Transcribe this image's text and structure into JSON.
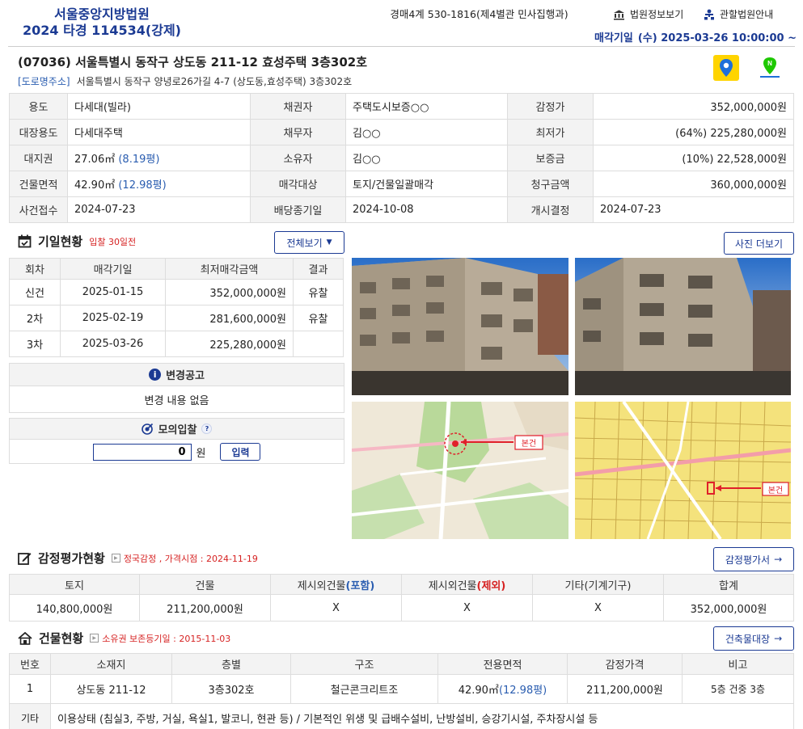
{
  "court": {
    "name": "서울중앙지방법원",
    "case": "2024 타경 114534(강제)"
  },
  "case_dept": "경매4계 530-1816(제4별관 민사집행과)",
  "links": {
    "court_info": "법원정보보기",
    "jurisdiction": "관할법원안내"
  },
  "sale_date": {
    "label": "매각기일",
    "value": "(수) 2025-03-26 10:00:00 ~"
  },
  "address": {
    "main": "(07036) 서울특별시 동작구 상도동 211-12 효성주택 3층302호",
    "road_tag": "[도로명주소]",
    "road": "서울특별시 동작구 양녕로26가길 4-7 (상도동,효성주택) 3층302호"
  },
  "info": {
    "usage_label": "용도",
    "usage": "다세대(빌라)",
    "creditor_label": "채권자",
    "creditor": "주택도시보증○○",
    "appraisal_label": "감정가",
    "appraisal": "352,000,000원",
    "main_usage_label": "대장용도",
    "main_usage": "다세대주택",
    "debtor_label": "채무자",
    "debtor": "김○○",
    "min_label": "최저가",
    "min_pct": "(64%)",
    "min": "225,280,000원",
    "land_label": "대지권",
    "land": "27.06㎡",
    "land_py": "(8.19평)",
    "owner_label": "소유자",
    "owner": "김○○",
    "deposit_label": "보증금",
    "deposit": "(10%) 22,528,000원",
    "bldg_label": "건물면적",
    "bldg": "42.90㎡",
    "bldg_py": "(12.98평)",
    "target_label": "매각대상",
    "target": "토지/건물일괄매각",
    "claim_label": "청구금액",
    "claim": "360,000,000원",
    "filed_label": "사건접수",
    "filed": "2024-07-23",
    "div_label": "배당종기일",
    "div": "2024-10-08",
    "start_label": "개시결정",
    "start": "2024-07-23"
  },
  "schedule": {
    "title": "기일현황",
    "badge": "입찰 30일전",
    "view_all": "전체보기",
    "headers": [
      "회차",
      "매각기일",
      "최저매각금액",
      "결과"
    ],
    "rows": [
      [
        "신건",
        "2025-01-15",
        "352,000,000원",
        "유찰"
      ],
      [
        "2차",
        "2025-02-19",
        "281,600,000원",
        "유찰"
      ],
      [
        "3차",
        "2025-03-26",
        "225,280,000원",
        ""
      ]
    ]
  },
  "change": {
    "title": "변경공고",
    "text": "변경 내용 없음"
  },
  "mock": {
    "title": "모의입찰",
    "help": "?",
    "value": "0",
    "unit": "원",
    "submit": "입력"
  },
  "photos_more": "사진 더보기",
  "map_label": "본건",
  "appraisal": {
    "title": "감정평가현황",
    "note": "정국감정 , 가격시점 : 2024-11-19",
    "button": "감정평가서",
    "headers": [
      "토지",
      "건물",
      "제시외건물",
      "(포함)",
      "제시외건물",
      "(제외)",
      "기타(기계기구)",
      "합계"
    ],
    "values": [
      "140,800,000원",
      "211,200,000원",
      "X",
      "X",
      "X",
      "352,000,000원"
    ]
  },
  "building": {
    "title": "건물현황",
    "note": "소유권 보존등기일 : 2015-11-03",
    "button": "건축물대장",
    "headers": [
      "번호",
      "소재지",
      "층별",
      "구조",
      "전용면적",
      "감정가격",
      "비고"
    ],
    "row": [
      "1",
      "상도동 211-12",
      "3층302호",
      "철근콘크리트조",
      "42.90㎡",
      "(12.98평)",
      "211,200,000원",
      "5층 건중 3층"
    ],
    "etc_label": "기타",
    "etc": "이용상태 (침실3, 주방, 거실, 욕실1, 발코니, 현관 등) / 기본적인 위생 및 급배수설비, 난방설비, 승강기시설, 주차장시설 등"
  }
}
